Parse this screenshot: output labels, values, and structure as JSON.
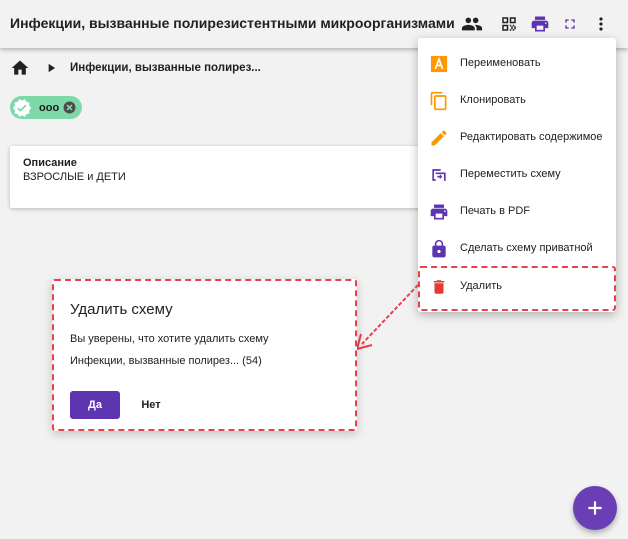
{
  "header": {
    "title": "Инфекции, вызванные полирезистентными микроорганизмами"
  },
  "breadcrumb": {
    "current": "Инфекции, вызванные полирез..."
  },
  "tag": {
    "label": "ооо"
  },
  "description": {
    "label": "Описание",
    "value": "ВЗРОСЛЫЕ и ДЕТИ"
  },
  "menu": {
    "items": [
      {
        "label": "Переименовать",
        "icon": "rename-icon"
      },
      {
        "label": "Клонировать",
        "icon": "copy-icon"
      },
      {
        "label": "Редактировать содержимое",
        "icon": "pencil-icon"
      },
      {
        "label": "Переместить схему",
        "icon": "move-icon"
      },
      {
        "label": "Печать в PDF",
        "icon": "print-icon"
      },
      {
        "label": "Сделать схему приватной",
        "icon": "lock-icon"
      },
      {
        "label": "Удалить",
        "icon": "trash-icon"
      }
    ]
  },
  "dialog": {
    "title": "Удалить схему",
    "question": "Вы уверены, что хотите удалить схему",
    "item": "Инфекции, вызванные полирез... (54)",
    "yes_label": "Да",
    "no_label": "Нет"
  },
  "colors": {
    "accent": "#5e35b1",
    "tag_bg": "#7ed9a9",
    "highlight": "#e8414d",
    "delete": "#e53935",
    "orange": "#ff9800"
  }
}
